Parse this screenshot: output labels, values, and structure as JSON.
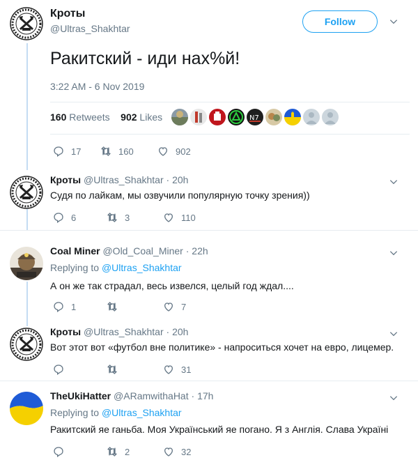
{
  "main_tweet": {
    "name": "Кроты",
    "handle": "@Ultras_Shakhtar",
    "follow_label": "Follow",
    "text": "Ракитский - иди нах%й!",
    "timestamp": "3:22 AM - 6 Nov 2019",
    "retweets_count": "160",
    "retweets_label": "Retweets",
    "likes_count": "902",
    "likes_label": "Likes",
    "actions": {
      "replies": "17",
      "retweets": "160",
      "likes": "902"
    }
  },
  "replies": [
    {
      "name": "Кроты",
      "handle": "@Ultras_Shakhtar",
      "time": "20h",
      "text": "Судя по лайкам, мы озвучили популярную точку зрения))",
      "actions": {
        "replies": "6",
        "retweets": "3",
        "likes": "110"
      }
    },
    {
      "name": "Coal Miner",
      "handle": "@Old_Coal_Miner",
      "time": "22h",
      "replying_prefix": "Replying to",
      "replying_to": "@Ultras_Shakhtar",
      "text": "А он же так страдал, весь извелся, целый год ждал....",
      "actions": {
        "replies": "1",
        "retweets": "",
        "likes": "7"
      }
    },
    {
      "name": "Кроты",
      "handle": "@Ultras_Shakhtar",
      "time": "20h",
      "text": "Вот этот вот «футбол вне политике» - напроситься хочет на евро, лицемер.",
      "actions": {
        "replies": "",
        "retweets": "",
        "likes": "31"
      }
    },
    {
      "name": "TheUkiHatter",
      "handle": "@ARamwithaHat",
      "time": "17h",
      "replying_prefix": "Replying to",
      "replying_to": "@Ultras_Shakhtar",
      "text": "Ракитский яе ганьба. Моя Український яе погано. Я з Англія. Слава Україні",
      "actions": {
        "replies": "",
        "retweets": "2",
        "likes": "32"
      }
    }
  ],
  "colors": {
    "accent": "#1da1f2",
    "thread_line": "#c4dcf3",
    "muted": "#657786",
    "divider": "#e6ecf0"
  },
  "icons": [
    "shakhtar-crest-icon",
    "chevron-down-icon",
    "reply-icon",
    "retweet-icon",
    "like-icon",
    "ukraine-flag-icon",
    "miner-avatar-icon"
  ]
}
